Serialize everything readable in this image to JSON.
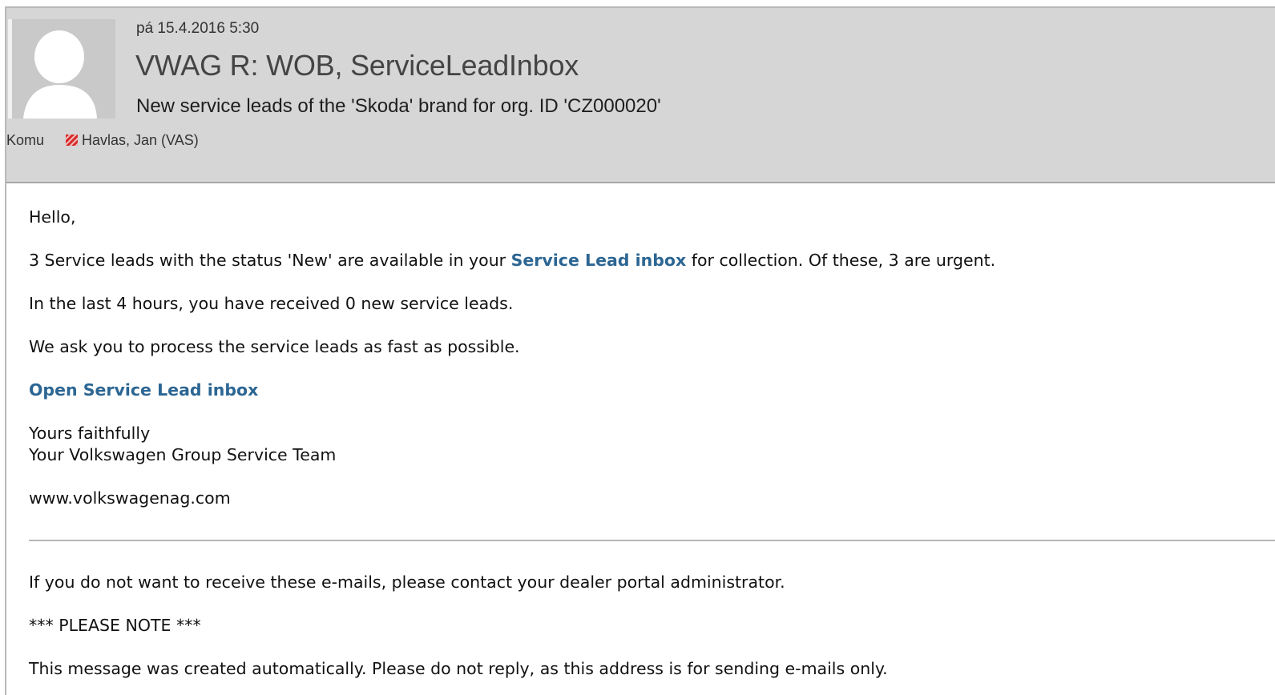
{
  "message": {
    "date": "pá 15.4.2016 5:30",
    "subject": "VWAG R: WOB, ServiceLeadInbox",
    "title": "New service leads of the 'Skoda' brand for org. ID 'CZ000020'",
    "to_label": "Komu",
    "recipient": "Havlas, Jan (VAS)"
  },
  "body": {
    "greeting": "Hello,",
    "leads_text_before": "3 Service leads with the status 'New' are available in your ",
    "leads_link": "Service Lead inbox",
    "leads_text_after": " for collection. Of these, 3 are urgent.",
    "recent": "In the last 4 hours, you have received 0 new service leads.",
    "request": "We ask you to process the service leads as fast as possible.",
    "open_link": "Open Service Lead inbox",
    "closing": "Yours faithfully",
    "team": "Your Volkswagen Group Service Team",
    "website": "www.volkswagenag.com",
    "unsubscribe": "If you do not want to receive these e-mails, please contact your dealer portal administrator.",
    "note": "*** PLEASE NOTE ***",
    "auto_message": "This message was created automatically. Please do not reply, as this address is for sending e-mails only."
  },
  "colors": {
    "header_bg": "#d6d6d6",
    "link": "#2c6693",
    "recipient_flag": "#d62727"
  },
  "icons": {
    "avatar": "person-silhouette-icon",
    "recipient": "flag-icon"
  }
}
